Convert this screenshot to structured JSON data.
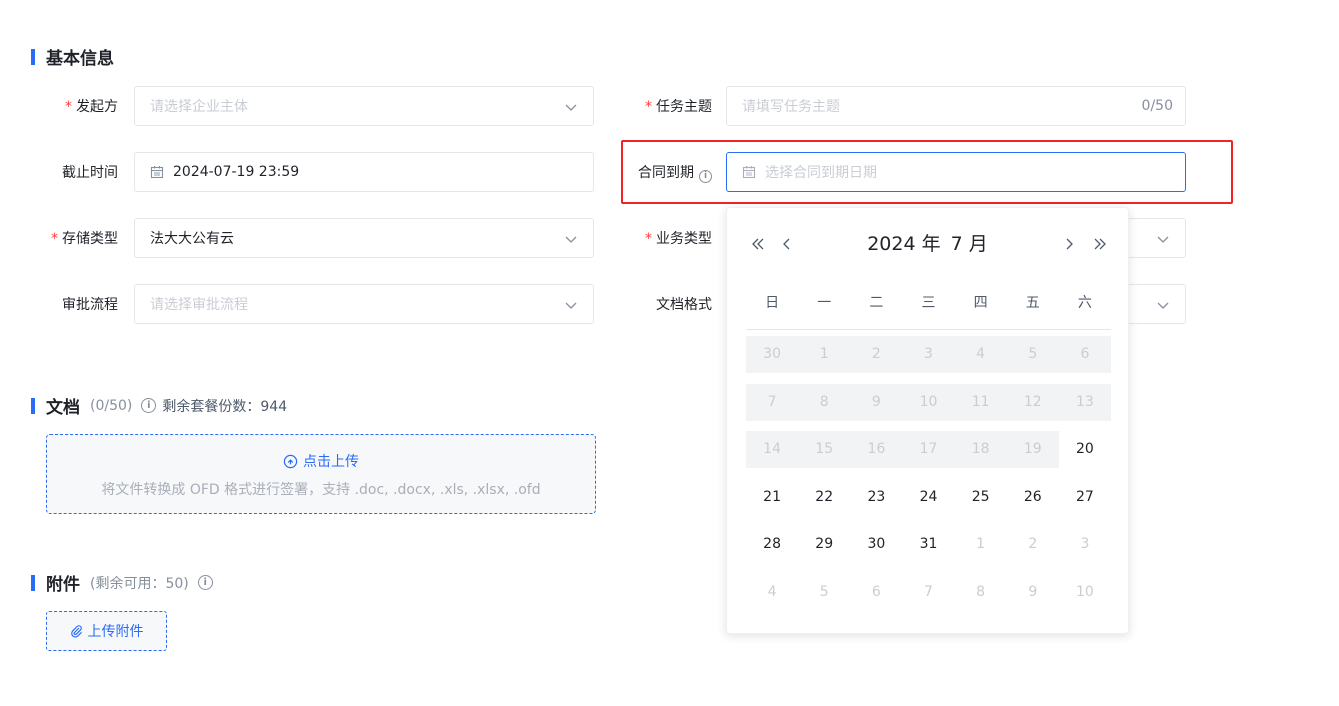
{
  "basic": {
    "title": "基本信息",
    "initiator": {
      "label": "发起方",
      "placeholder": "请选择企业主体"
    },
    "subject": {
      "label": "任务主题",
      "placeholder": "请填写任务主题",
      "count": "0/50"
    },
    "deadline": {
      "label": "截止时间",
      "value": "2024-07-19 23:59"
    },
    "expire": {
      "label": "合同到期",
      "placeholder": "选择合同到期日期"
    },
    "storage": {
      "label": "存储类型",
      "value": "法大大公有云"
    },
    "biz": {
      "label": "业务类型"
    },
    "approval": {
      "label": "审批流程",
      "placeholder": "请选择审批流程"
    },
    "docformat": {
      "label": "文档格式"
    }
  },
  "docs": {
    "title": "文档",
    "count": "(0/50)",
    "remaining": "剩余套餐份数：944",
    "upload_label": "点击上传",
    "upload_hint": "将文件转换成 OFD 格式进行签署，支持 .doc, .docx, .xls, .xlsx, .ofd"
  },
  "attach": {
    "title": "附件",
    "remaining": "(剩余可用：50)",
    "button": "上传附件"
  },
  "calendar": {
    "year": "2024 年",
    "month": "7 月",
    "weekdays": [
      "日",
      "一",
      "二",
      "三",
      "四",
      "五",
      "六"
    ],
    "weeks": [
      [
        {
          "d": "30",
          "s": "dis"
        },
        {
          "d": "1",
          "s": "dis"
        },
        {
          "d": "2",
          "s": "dis"
        },
        {
          "d": "3",
          "s": "dis"
        },
        {
          "d": "4",
          "s": "dis"
        },
        {
          "d": "5",
          "s": "dis"
        },
        {
          "d": "6",
          "s": "dis"
        }
      ],
      [
        {
          "d": "7",
          "s": "dis"
        },
        {
          "d": "8",
          "s": "dis"
        },
        {
          "d": "9",
          "s": "dis"
        },
        {
          "d": "10",
          "s": "dis"
        },
        {
          "d": "11",
          "s": "dis"
        },
        {
          "d": "12",
          "s": "dis"
        },
        {
          "d": "13",
          "s": "dis"
        }
      ],
      [
        {
          "d": "14",
          "s": "dis"
        },
        {
          "d": "15",
          "s": "dis"
        },
        {
          "d": "16",
          "s": "dis"
        },
        {
          "d": "17",
          "s": "dis"
        },
        {
          "d": "18",
          "s": "dis"
        },
        {
          "d": "19",
          "s": "dis"
        },
        {
          "d": "20",
          "s": ""
        }
      ],
      [
        {
          "d": "21",
          "s": ""
        },
        {
          "d": "22",
          "s": ""
        },
        {
          "d": "23",
          "s": ""
        },
        {
          "d": "24",
          "s": ""
        },
        {
          "d": "25",
          "s": ""
        },
        {
          "d": "26",
          "s": ""
        },
        {
          "d": "27",
          "s": ""
        }
      ],
      [
        {
          "d": "28",
          "s": ""
        },
        {
          "d": "29",
          "s": ""
        },
        {
          "d": "30",
          "s": ""
        },
        {
          "d": "31",
          "s": ""
        },
        {
          "d": "1",
          "s": "out"
        },
        {
          "d": "2",
          "s": "out"
        },
        {
          "d": "3",
          "s": "out"
        }
      ],
      [
        {
          "d": "4",
          "s": "out"
        },
        {
          "d": "5",
          "s": "out"
        },
        {
          "d": "6",
          "s": "out"
        },
        {
          "d": "7",
          "s": "out"
        },
        {
          "d": "8",
          "s": "out"
        },
        {
          "d": "9",
          "s": "out"
        },
        {
          "d": "10",
          "s": "out"
        }
      ]
    ]
  },
  "colors": {
    "accent": "#2b6cf6",
    "required": "#f53f3f",
    "highlight_box": "#f02424"
  }
}
